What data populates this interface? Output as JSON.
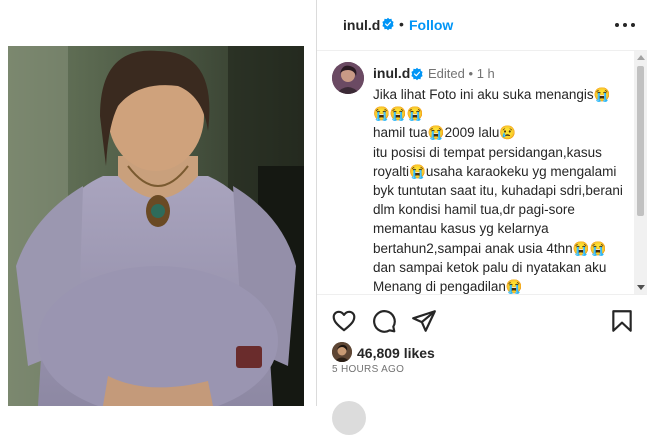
{
  "post": {
    "username": "inul.d",
    "separator": "•",
    "follow_label": "Follow"
  },
  "caption": {
    "username": "inul.d",
    "edited": "Edited",
    "separator": "•",
    "time_ago": "1 h",
    "text": "Jika lihat Foto ini aku suka menangis😭\n😭😭😭\nhamil tua😭2009 lalu😢\nitu posisi di tempat persidangan,kasus royalti😭usaha karaokeku yg mengalami byk tuntutan saat itu, kuhadapi sdri,berani dlm kondisi hamil tua,dr pagi-sore memantau kasus yg kelarnya bertahun2,sampai anak usia 4thn😭😭dan sampai ketok palu di nyatakan aku Menang di pengadilan😭\nproses yg sangat panjang,dan ini yg"
  },
  "actions": {
    "likes": "46,809 likes",
    "timestamp": "5 HOURS AGO"
  },
  "icons": {
    "verified": "verified-badge-icon",
    "more": "more-options-icon",
    "like": "heart-icon",
    "comment": "comment-bubble-icon",
    "share": "paper-plane-icon",
    "save": "bookmark-icon"
  },
  "colors": {
    "accent": "#0095f6",
    "text": "#262626",
    "secondary": "#737373",
    "divider": "#dbdbdb"
  }
}
